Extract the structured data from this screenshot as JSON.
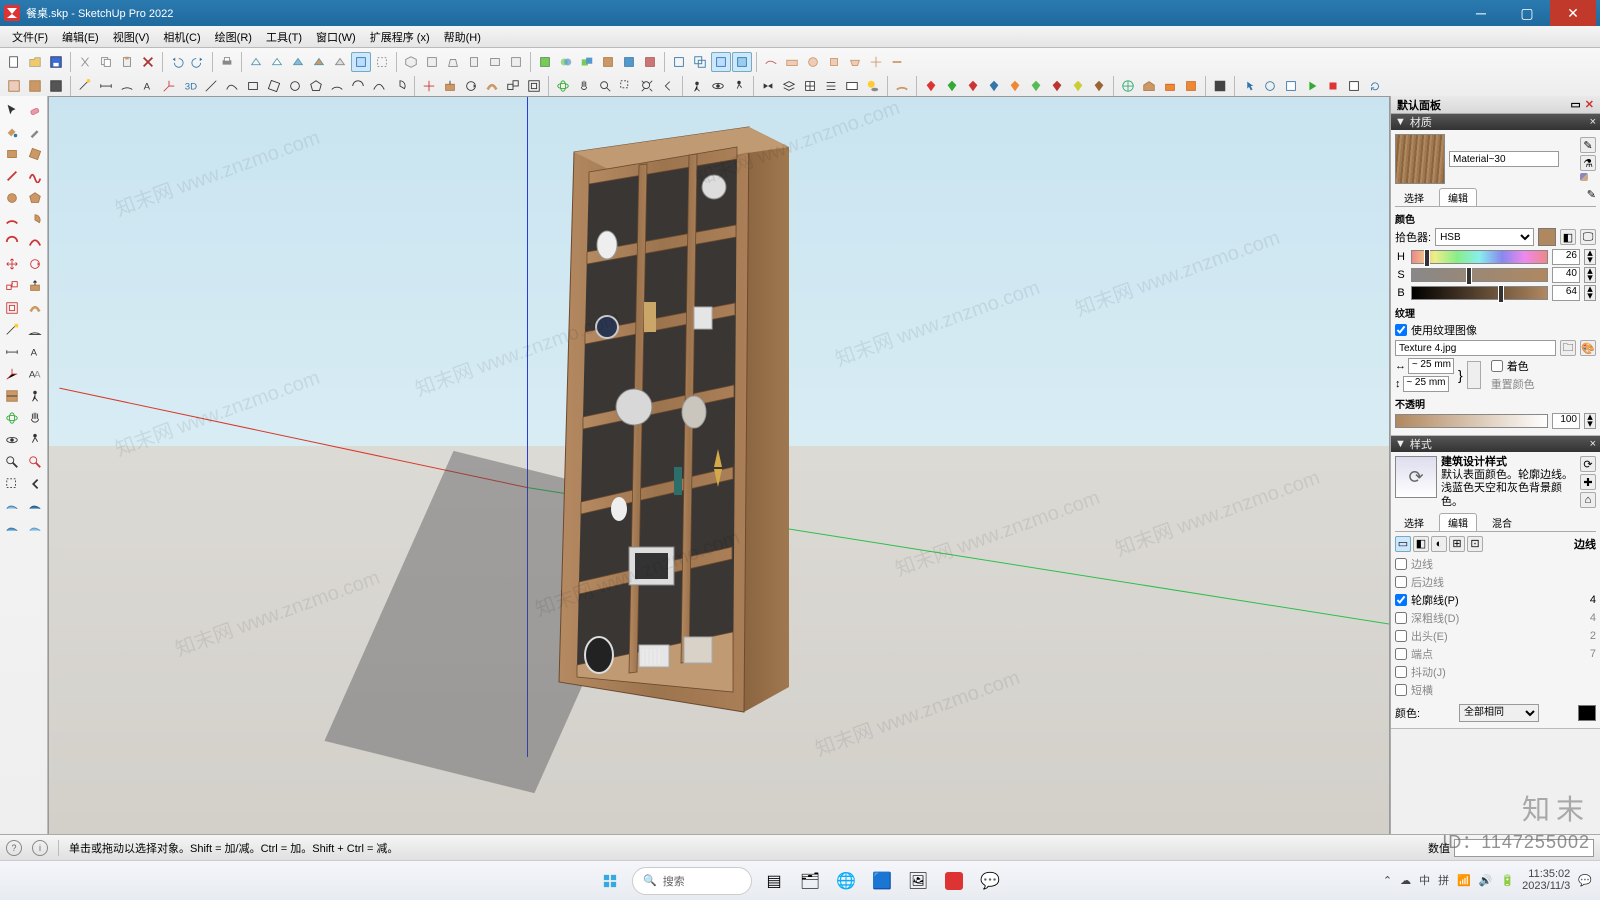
{
  "window": {
    "filename": "餐桌.skp",
    "app": "SketchUp Pro 2022",
    "title": "餐桌.skp - SketchUp Pro 2022"
  },
  "menu": {
    "file": "文件(F)",
    "edit": "编辑(E)",
    "view": "视图(V)",
    "camera": "相机(C)",
    "draw": "绘图(R)",
    "tools": "工具(T)",
    "window": "窗口(W)",
    "ext": "扩展程序 (x)",
    "help": "帮助(H)"
  },
  "tray": {
    "title": "默认面板"
  },
  "materials": {
    "header": "材质",
    "name": "Material~30",
    "tab_select": "选择",
    "tab_edit": "编辑",
    "color_section": "颜色",
    "picker_label": "拾色器:",
    "picker_mode": "HSB",
    "h_label": "H",
    "h_val": "26",
    "s_label": "S",
    "s_val": "40",
    "b_label": "B",
    "b_val": "64",
    "texture_section": "纹理",
    "use_texture": "使用纹理图像",
    "texture_file": "Texture 4.jpg",
    "dim_w": "~ 25 mm",
    "dim_h": "~ 25 mm",
    "colorize": "着色",
    "reset_color": "重置颜色",
    "opacity_section": "不透明",
    "opacity_val": "100"
  },
  "styles": {
    "header": "样式",
    "name": "建筑设计样式",
    "desc": "默认表面颜色。轮廓边线。浅蓝色天空和灰色背景颜色。",
    "tab_select": "选择",
    "tab_edit": "编辑",
    "tab_mix": "混合",
    "edges_header": "边线",
    "edge_edges": "边线",
    "edge_back": "后边线",
    "edge_profiles": "轮廓线(P)",
    "profiles_val": "4",
    "edge_depth": "深粗线(D)",
    "depth_val": "4",
    "edge_ext": "出头(E)",
    "ext_val": "2",
    "edge_end": "端点",
    "end_val": "7",
    "edge_jitter": "抖动(J)",
    "edge_dashes": "短横",
    "color_label": "颜色:",
    "color_mode": "全部相同"
  },
  "status": {
    "hint": "单击或拖动以选择对象。Shift = 加/减。Ctrl = 加。Shift + Ctrl = 减。",
    "measure_label": "数值"
  },
  "taskbar": {
    "search": "搜索",
    "time": "11:35:02",
    "date": "2023/11/3",
    "ime": "中",
    "ime2": "拼"
  },
  "watermark": {
    "text": "知末网 www.znzmo.com",
    "brand": "知末",
    "id": "ID：1147255002"
  }
}
